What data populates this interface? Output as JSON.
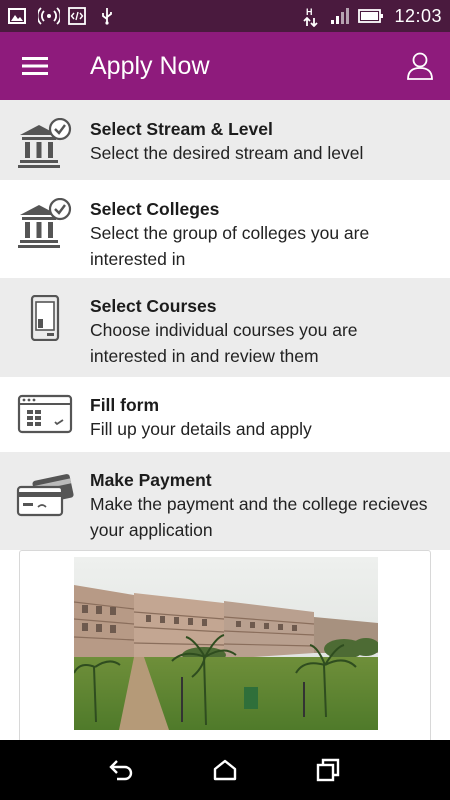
{
  "status_bar": {
    "time": "12:03",
    "icons": [
      "image-icon",
      "wifi-hotspot-icon",
      "code-icon",
      "usb-icon",
      "network-arrows-icon",
      "signal-icon",
      "battery-icon"
    ]
  },
  "app_bar": {
    "title": "Apply Now",
    "menu_icon": "hamburger-menu-icon",
    "profile_icon": "user-profile-icon",
    "color": "#8e1b7c"
  },
  "steps": [
    {
      "title": "Select Stream & Level",
      "desc": "Select the desired stream and level",
      "icon": "institution-check-icon"
    },
    {
      "title": "Select Colleges",
      "desc": "Select the group of colleges you are interested in",
      "icon": "institution-check-icon"
    },
    {
      "title": "Select Courses",
      "desc": "Choose individual courses you are interested in and review them",
      "icon": "mobile-phone-icon"
    },
    {
      "title": "Fill form",
      "desc": "Fill up your details and apply",
      "icon": "browser-form-icon"
    },
    {
      "title": "Make Payment",
      "desc": "Make the payment and the college recieves your application",
      "icon": "credit-card-icon"
    }
  ],
  "nav_bar": {
    "icons": [
      "back-icon",
      "home-icon",
      "recents-icon"
    ]
  }
}
